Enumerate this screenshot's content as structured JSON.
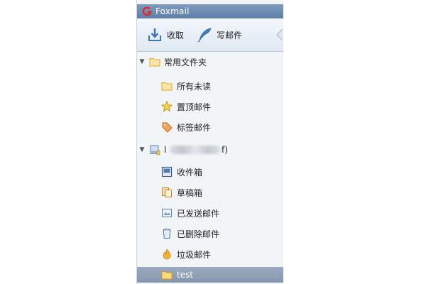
{
  "window": {
    "title": "Foxmail"
  },
  "toolbar": {
    "receive_label": "收取",
    "compose_label": "写邮件"
  },
  "tree": {
    "groups": [
      {
        "label": "常用文件夹",
        "expanded": true,
        "items": [
          {
            "label": "所有未读",
            "icon": "folder-icon"
          },
          {
            "label": "置顶邮件",
            "icon": "star-icon"
          },
          {
            "label": "标签邮件",
            "icon": "tag-icon"
          }
        ]
      },
      {
        "account_prefix": "l",
        "account_suffix": "f)",
        "account_blurred": true,
        "expanded": true,
        "items": [
          {
            "label": "收件箱",
            "icon": "inbox-icon"
          },
          {
            "label": "草稿箱",
            "icon": "drafts-icon"
          },
          {
            "label": "已发送邮件",
            "icon": "sent-icon"
          },
          {
            "label": "已删除邮件",
            "icon": "trash-icon"
          },
          {
            "label": "垃圾邮件",
            "icon": "junk-icon"
          },
          {
            "label": "test",
            "icon": "folder-icon",
            "selected": true
          }
        ]
      }
    ]
  },
  "colors": {
    "titlebar": "#6f8db4",
    "selection": "#8d9db5",
    "folder": "#f3c04e",
    "logo": "#e2282a"
  }
}
